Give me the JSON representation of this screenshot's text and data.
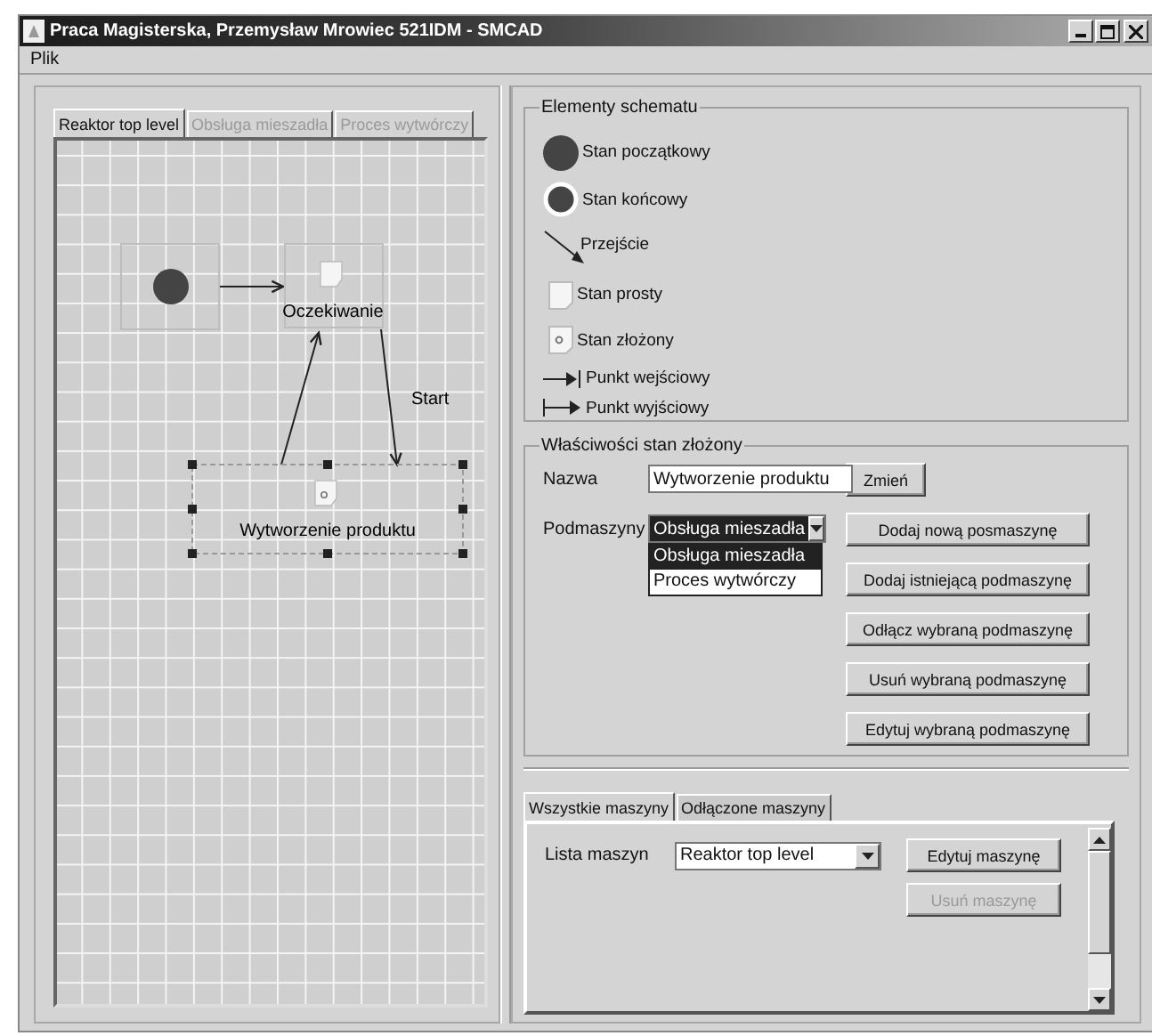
{
  "window": {
    "title": "Praca Magisterska, Przemysław Mrowiec 521IDM - SMCAD"
  },
  "menu": [
    "Plik"
  ],
  "diagram_tabs": [
    {
      "label": "Reaktor top level",
      "selected": true,
      "disabled": false
    },
    {
      "label": "Obsługa mieszadła",
      "selected": false,
      "disabled": true
    },
    {
      "label": "Proces wytwórczy",
      "selected": false,
      "disabled": true
    }
  ],
  "diagram": {
    "nodes": [
      {
        "kind": "initial"
      },
      {
        "kind": "simple",
        "label": "Oczekiwanie",
        "selected": false
      },
      {
        "kind": "composite",
        "label": "Wytworzenie produktu",
        "selected": true
      }
    ],
    "transitions": [
      {
        "kind": "plain"
      },
      {
        "kind": "plain"
      },
      {
        "kind": "labeled",
        "label": "Start"
      }
    ]
  },
  "palette": {
    "title": "Elementy schematu",
    "items": [
      {
        "kind": "initial",
        "label": "Stan początkowy"
      },
      {
        "kind": "final",
        "label": "Stan końcowy"
      },
      {
        "kind": "transition",
        "label": "Przejście"
      },
      {
        "kind": "simple",
        "label": "Stan prosty"
      },
      {
        "kind": "composite",
        "label": "Stan złożony"
      },
      {
        "kind": "entry",
        "label": "Punkt wejściowy"
      },
      {
        "kind": "exit",
        "label": "Punkt wyjściowy"
      }
    ]
  },
  "properties": {
    "title": "Właściwości stan złożony",
    "name_label": "Nazwa",
    "name_value": "Wytworzenie produktu",
    "change_button": "Zmień",
    "submachines_label": "Podmaszyny",
    "submachines_value": "Obsługa mieszadła",
    "dropdown_open": true,
    "options": [
      {
        "label": "Obsługa mieszadła",
        "selected": true
      },
      {
        "label": "Proces wytwórczy",
        "selected": false
      }
    ],
    "buttons": [
      "Dodaj nową posmaszynę",
      "Dodaj istniejącą podmaszynę",
      "Odłącz wybraną podmaszynę",
      "Usuń wybraną podmaszynę",
      "Edytuj wybraną podmaszynę"
    ]
  },
  "machine_tabs": [
    {
      "label": "Wszystkie maszyny",
      "selected": true
    },
    {
      "label": "Odłączone maszyny",
      "selected": false
    }
  ],
  "machines": {
    "label": "Lista maszyn",
    "value": "Reaktor top level",
    "buttons": [
      {
        "label": "Edytuj maszynę",
        "disabled": false
      },
      {
        "label": "Usuń maszynę",
        "disabled": true
      }
    ]
  }
}
